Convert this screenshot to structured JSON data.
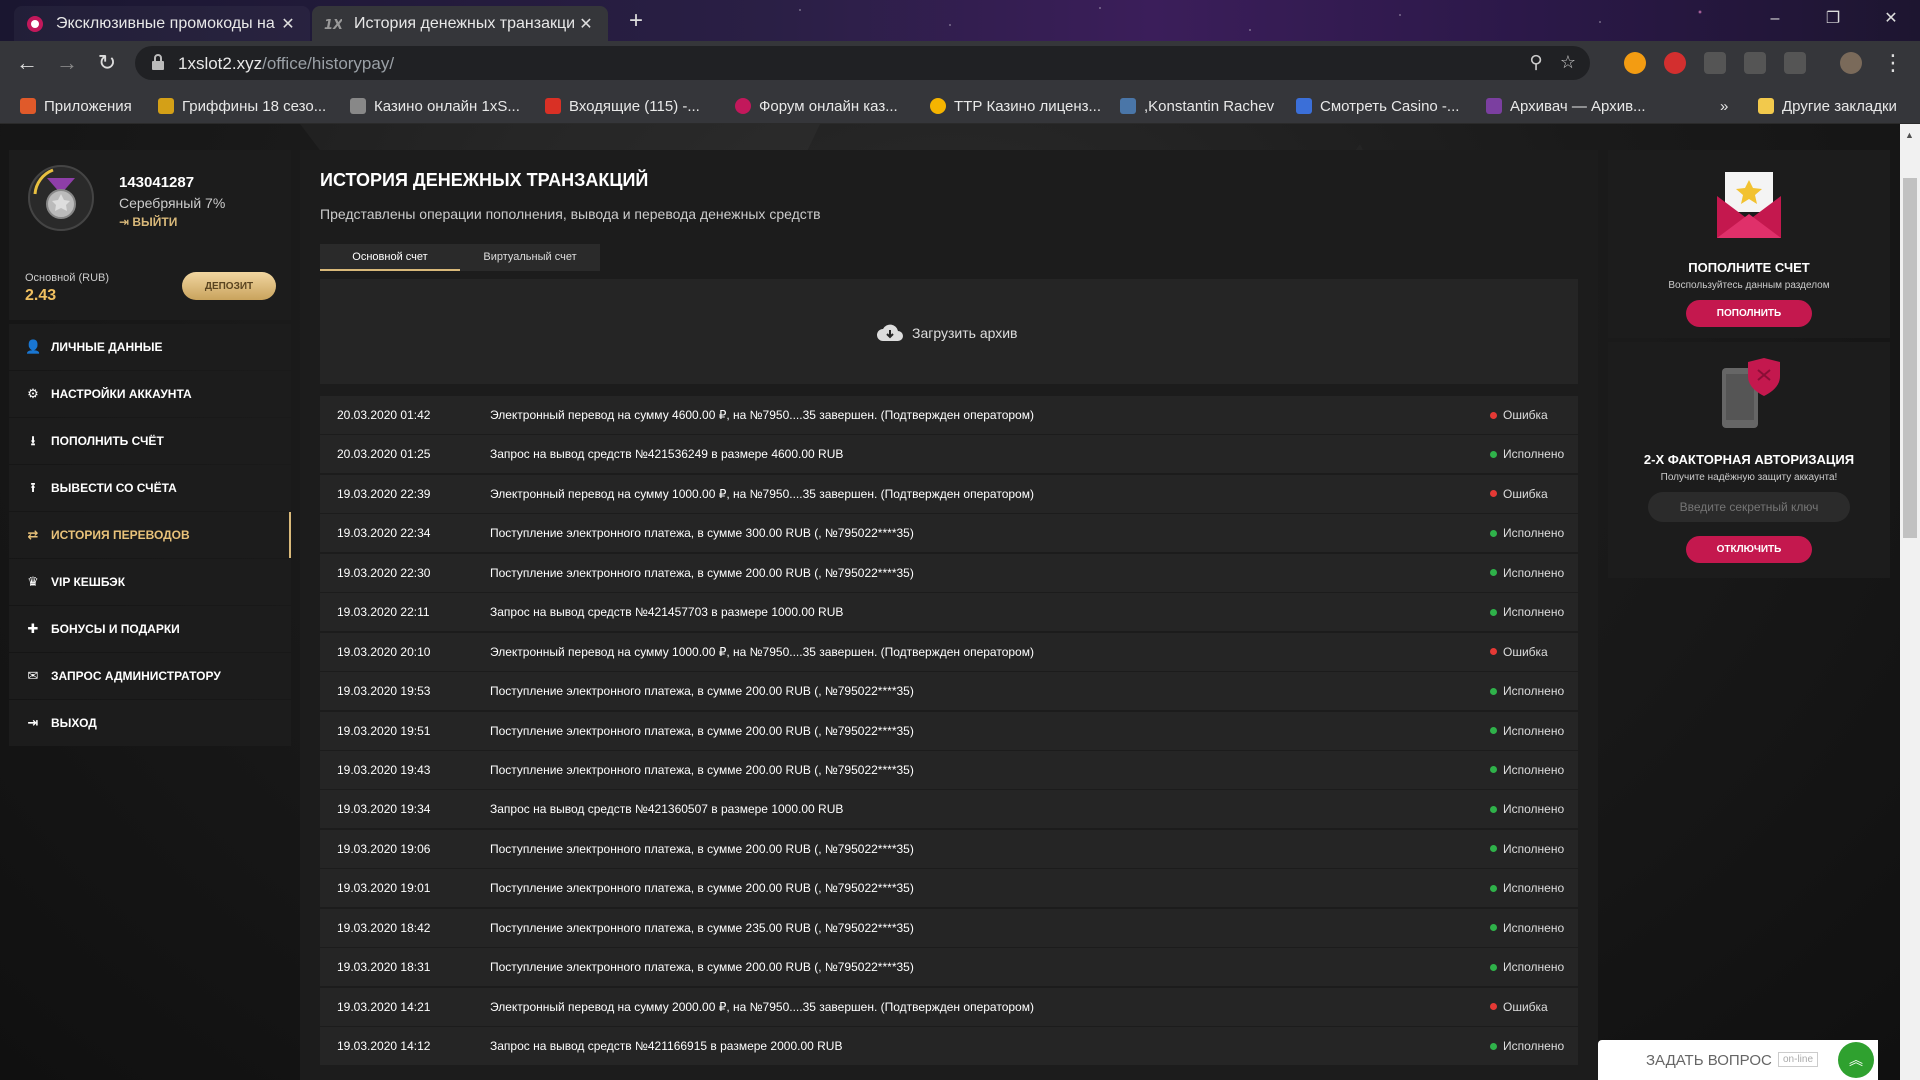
{
  "browser": {
    "tabs": [
      {
        "title": "Эксклюзивные промокоды на «",
        "active": false
      },
      {
        "title": "История денежных транзакций",
        "active": true
      }
    ],
    "new_tab": "+",
    "url_host": "1xslot2.xyz",
    "url_path": "/office/historypay/",
    "window_controls": {
      "minimize": "–",
      "restore": "❐",
      "close": "✕"
    },
    "bookmarks": [
      {
        "label": "Приложения",
        "icon": "apps-icon",
        "color": "#e05a2a"
      },
      {
        "label": "Гриффины 18 сезо...",
        "icon": "griffins-icon",
        "color": "#d4a017"
      },
      {
        "label": "Казино онлайн 1xS...",
        "icon": "1x-icon",
        "color": "#888888"
      },
      {
        "label": "Входящие (115) -...",
        "icon": "gmail-icon",
        "color": "#d93025"
      },
      {
        "label": "Форум онлайн каз...",
        "icon": "forum-icon",
        "color": "#c2185b"
      },
      {
        "label": "ТТР Казино лиценз...",
        "icon": "ttr-icon",
        "color": "#f5b400"
      },
      {
        "label": ",Konstantin Rachev",
        "icon": "vk-icon",
        "color": "#4a76a8"
      },
      {
        "label": "Смотреть Casino -...",
        "icon": "star-icon",
        "color": "#3b6fd8"
      },
      {
        "label": "Архивач — Архив...",
        "icon": "archive-icon",
        "color": "#7b3fa0"
      }
    ],
    "bookmarks_more": "»",
    "other_bookmarks": "Другие закладки"
  },
  "profile": {
    "id": "143041287",
    "level": "Серебряный 7%",
    "logout": "ВЫЙТИ",
    "balance_label": "Основной (RUB)",
    "balance": "2.43",
    "deposit": "ДЕПОЗИТ"
  },
  "menu": [
    {
      "label": "ЛИЧНЫЕ ДАННЫЕ",
      "icon": "user-add-icon",
      "glyph": "👤"
    },
    {
      "label": "НАСТРОЙКИ АККАУНТА",
      "icon": "gears-icon",
      "glyph": "⚙"
    },
    {
      "label": "ПОПОЛНИТЬ СЧЁТ",
      "icon": "download-icon",
      "glyph": "⭳"
    },
    {
      "label": "ВЫВЕСТИ СО СЧЁТА",
      "icon": "upload-icon",
      "glyph": "⭱"
    },
    {
      "label": "ИСТОРИЯ ПЕРЕВОДОВ",
      "icon": "transfer-icon",
      "glyph": "⇄",
      "active": true
    },
    {
      "label": "VIP КЕШБЭК",
      "icon": "crown-icon",
      "glyph": "♛"
    },
    {
      "label": "БОНУСЫ И ПОДАРКИ",
      "icon": "gift-icon",
      "glyph": "🎁"
    },
    {
      "label": "ЗАПРОС АДМИНИСТРАТОРУ",
      "icon": "mail-icon",
      "glyph": "✉"
    },
    {
      "label": "ВЫХОД",
      "icon": "exit-icon",
      "glyph": "⇥"
    }
  ],
  "main": {
    "title": "ИСТОРИЯ ДЕНЕЖНЫХ ТРАНЗАКЦИЙ",
    "subtitle": "Представлены операции пополнения, вывода и перевода денежных средств",
    "tabs": [
      "Основной счет",
      "Виртуальный счет"
    ],
    "archive": "Загрузить архив",
    "transactions": [
      {
        "date": "20.03.2020 01:42",
        "desc": "Электронный перевод на сумму 4600.00 ₽, на №7950....35 завершен. (Подтвержден оператором)",
        "status": "Ошибка",
        "ok": false
      },
      {
        "date": "20.03.2020 01:25",
        "desc": "Запрос на вывод средств №421536249 в размере 4600.00 RUB",
        "status": "Исполнено",
        "ok": true
      },
      {
        "date": "19.03.2020 22:39",
        "desc": "Электронный перевод на сумму 1000.00 ₽, на №7950....35 завершен. (Подтвержден оператором)",
        "status": "Ошибка",
        "ok": false
      },
      {
        "date": "19.03.2020 22:34",
        "desc": "Поступление электронного платежа, в сумме 300.00 RUB (, №795022****35)",
        "status": "Исполнено",
        "ok": true
      },
      {
        "date": "19.03.2020 22:30",
        "desc": "Поступление электронного платежа, в сумме 200.00 RUB (, №795022****35)",
        "status": "Исполнено",
        "ok": true
      },
      {
        "date": "19.03.2020 22:11",
        "desc": "Запрос на вывод средств №421457703 в размере 1000.00 RUB",
        "status": "Исполнено",
        "ok": true
      },
      {
        "date": "19.03.2020 20:10",
        "desc": "Электронный перевод на сумму 1000.00 ₽, на №7950....35 завершен. (Подтвержден оператором)",
        "status": "Ошибка",
        "ok": false
      },
      {
        "date": "19.03.2020 19:53",
        "desc": "Поступление электронного платежа, в сумме 200.00 RUB (, №795022****35)",
        "status": "Исполнено",
        "ok": true
      },
      {
        "date": "19.03.2020 19:51",
        "desc": "Поступление электронного платежа, в сумме 200.00 RUB (, №795022****35)",
        "status": "Исполнено",
        "ok": true
      },
      {
        "date": "19.03.2020 19:43",
        "desc": "Поступление электронного платежа, в сумме 200.00 RUB (, №795022****35)",
        "status": "Исполнено",
        "ok": true
      },
      {
        "date": "19.03.2020 19:34",
        "desc": "Запрос на вывод средств №421360507 в размере 1000.00 RUB",
        "status": "Исполнено",
        "ok": true
      },
      {
        "date": "19.03.2020 19:06",
        "desc": "Поступление электронного платежа, в сумме 200.00 RUB (, №795022****35)",
        "status": "Исполнено",
        "ok": true
      },
      {
        "date": "19.03.2020 19:01",
        "desc": "Поступление электронного платежа, в сумме 200.00 RUB (, №795022****35)",
        "status": "Исполнено",
        "ok": true
      },
      {
        "date": "19.03.2020 18:42",
        "desc": "Поступление электронного платежа, в сумме 235.00 RUB (, №795022****35)",
        "status": "Исполнено",
        "ok": true
      },
      {
        "date": "19.03.2020 18:31",
        "desc": "Поступление электронного платежа, в сумме 200.00 RUB (, №795022****35)",
        "status": "Исполнено",
        "ok": true
      },
      {
        "date": "19.03.2020 14:21",
        "desc": "Электронный перевод на сумму 2000.00 ₽, на №7950....35 завершен. (Подтвержден оператором)",
        "status": "Ошибка",
        "ok": false
      },
      {
        "date": "19.03.2020 14:12",
        "desc": "Запрос на вывод средств №421166915 в размере 2000.00 RUB",
        "status": "Исполнено",
        "ok": true
      }
    ]
  },
  "widgets": {
    "topup": {
      "title": "ПОПОЛНИТЕ СЧЕТ",
      "subtitle": "Воспользуйтесь данным разделом",
      "button": "ПОПОЛНИТЬ"
    },
    "twofa": {
      "title": "2-Х ФАКТОРНАЯ АВТОРИЗАЦИЯ",
      "subtitle": "Получите надёжную защиту аккаунта!",
      "placeholder": "Введите секретный ключ",
      "button": "ОТКЛЮЧИТЬ"
    }
  },
  "support": {
    "label": "ЗАДАТЬ ВОПРОС",
    "badge": "on-line"
  },
  "colors": {
    "accent_gold": "#d9b97a",
    "error": "#e53935",
    "success": "#2fb24a",
    "pink_button": "#c4184e"
  }
}
